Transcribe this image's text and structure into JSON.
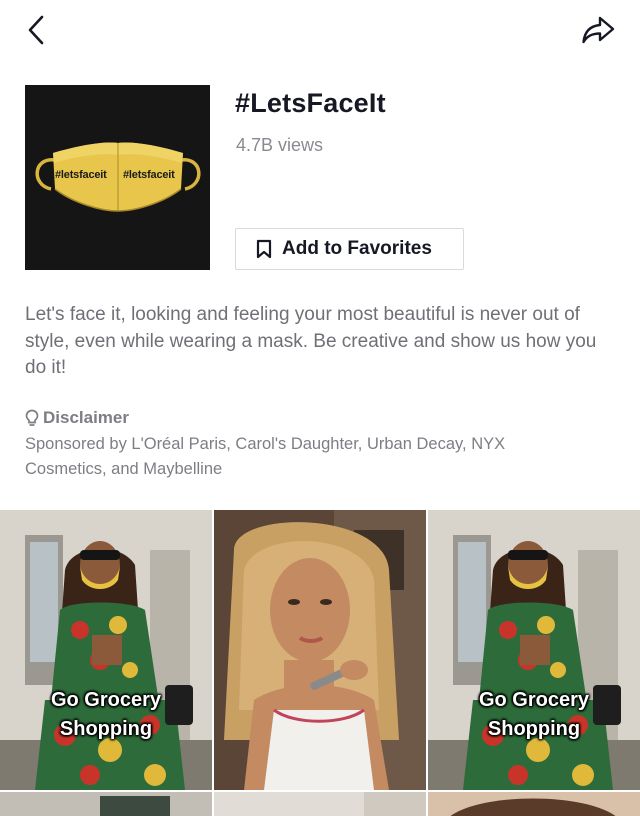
{
  "header": {
    "back_icon": "chevron-left-icon",
    "share_icon": "share-arrow-icon"
  },
  "hashtag": {
    "title": "#LetsFaceIt",
    "views": "4.7B views",
    "cover_mask_text_left": "#letsfaceit",
    "cover_mask_text_right": "#letsfaceit",
    "favorite_label": "Add to Favorites",
    "favorite_icon": "bookmark-icon"
  },
  "description": "Let's face it, looking and feeling your most beautiful is never out of style, even while wearing a mask. Be creative and show us how you do it!",
  "disclaimer": {
    "icon": "lightbulb-icon",
    "heading": "Disclaimer",
    "text": "Sponsored by L'Oréal Paris, Carol's Daughter, Urban Decay, NYX Cosmetics, and Maybelline"
  },
  "videos": [
    {
      "caption_line1": "Go Grocery",
      "caption_line2": "Shopping"
    },
    {
      "caption_line1": "",
      "caption_line2": ""
    },
    {
      "caption_line1": "Go Grocery",
      "caption_line2": "Shopping"
    }
  ],
  "colors": {
    "text_primary": "#161823",
    "text_secondary": "#8a8b91",
    "mask_gold": "#e7c64b",
    "cover_bg": "#151515"
  }
}
